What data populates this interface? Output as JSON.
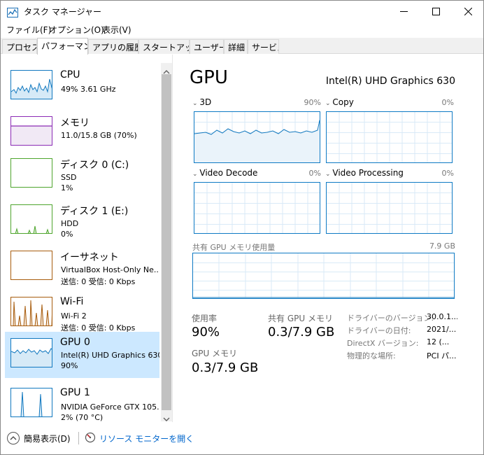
{
  "window": {
    "title": "タスク マネージャー",
    "controls": {
      "minimize": "minimize",
      "maximize": "maximize",
      "close": "close"
    }
  },
  "menu": [
    "ファイル(F)",
    "オプション(O)",
    "表示(V)"
  ],
  "tabs": [
    {
      "label": "プロセス",
      "active": false
    },
    {
      "label": "パフォーマンス",
      "active": true
    },
    {
      "label": "アプリの履歴",
      "active": false
    },
    {
      "label": "スタートアップ",
      "active": false
    },
    {
      "label": "ユーザー",
      "active": false
    },
    {
      "label": "詳細",
      "active": false
    },
    {
      "label": "サービス",
      "active": false
    }
  ],
  "sidebar": {
    "items": [
      {
        "name": "CPU",
        "line1": "49%  3.61 GHz",
        "line2": "",
        "color": "#1178bf",
        "kind": "cpu",
        "selected": false
      },
      {
        "name": "メモリ",
        "line1": "11.0/15.8 GB (70%)",
        "line2": "",
        "color": "#8b2bb5",
        "kind": "mem",
        "selected": false
      },
      {
        "name": "ディスク 0 (C:)",
        "line1": "SSD",
        "line2": "1%",
        "color": "#4ea52d",
        "kind": "disk0",
        "selected": false
      },
      {
        "name": "ディスク 1 (E:)",
        "line1": "HDD",
        "line2": "0%",
        "color": "#4ea52d",
        "kind": "disk1",
        "selected": false
      },
      {
        "name": "イーサネット",
        "line1": "VirtualBox Host-Only Ne...",
        "line2": "送信: 0 受信: 0 Kbps",
        "color": "#a75c0d",
        "kind": "eth",
        "selected": false
      },
      {
        "name": "Wi-Fi",
        "line1": "Wi-Fi 2",
        "line2": "送信: 0 受信: 0 Kbps",
        "color": "#a75c0d",
        "kind": "wifi",
        "selected": false
      },
      {
        "name": "GPU 0",
        "line1": "Intel(R) UHD Graphics 630",
        "line2": "90%",
        "color": "#1178bf",
        "kind": "gpu0",
        "selected": true
      },
      {
        "name": "GPU 1",
        "line1": "NVIDIA GeForce GTX 105...",
        "line2": "2% (70 °C)",
        "color": "#1178bf",
        "kind": "gpu1",
        "selected": false
      }
    ]
  },
  "main": {
    "title": "GPU",
    "model": "Intel(R) UHD Graphics 630",
    "engines": [
      {
        "name": "3D",
        "pct": "90%"
      },
      {
        "name": "Copy",
        "pct": "0%"
      },
      {
        "name": "Video Decode",
        "pct": "0%"
      },
      {
        "name": "Video Processing",
        "pct": "0%"
      }
    ],
    "shared_memory_label": "共有 GPU メモリ使用量",
    "shared_memory_max": "7.9 GB",
    "stats": {
      "usage_label": "使用率",
      "usage_value": "90%",
      "shared_label": "共有 GPU メモリ",
      "shared_value": "0.3/7.9 GB",
      "gpu_mem_label": "GPU メモリ",
      "gpu_mem_value": "0.3/7.9 GB"
    },
    "properties": [
      {
        "label": "ドライバーのバージョン:",
        "value": "30.0.1..."
      },
      {
        "label": "ドライバーの日付:",
        "value": "2021/..."
      },
      {
        "label": "DirectX バージョン:",
        "value": "12 (..."
      },
      {
        "label": "物理的な場所:",
        "value": "PCI パ..."
      }
    ]
  },
  "footer": {
    "fewer_details": "簡易表示(D)",
    "resource_monitor": "リソース モニターを開く"
  },
  "colors": {
    "accent": "#0e7ac4",
    "selected_bg": "#cce8ff"
  }
}
